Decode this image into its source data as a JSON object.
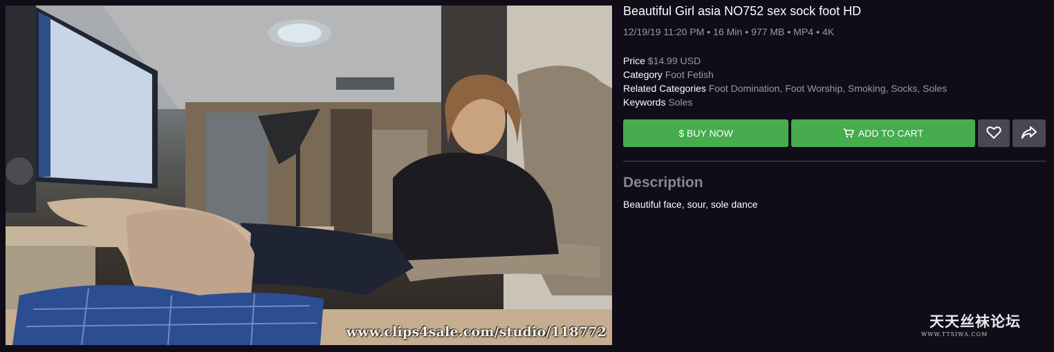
{
  "preview": {
    "watermark": "www.clips4sale.com/studio/118772"
  },
  "product": {
    "title": "Beautiful Girl asia NO752 sex sock foot HD",
    "meta": {
      "date": "12/19/19 11:20 PM",
      "duration": "16 Min",
      "size": "977 MB",
      "format": "MP4",
      "resolution": "4K",
      "separator": "•"
    },
    "details": {
      "price_label": "Price",
      "price_value": "$14.99 USD",
      "category_label": "Category",
      "category_value": "Foot Fetish",
      "related_label": "Related Categories",
      "related_value": "Foot Domination, Foot Worship, Smoking, Socks, Soles",
      "keywords_label": "Keywords",
      "keywords_value": "Soles"
    }
  },
  "actions": {
    "buy_label": "$ BUY NOW",
    "cart_label": "ADD TO CART",
    "cart_icon": "cart-icon",
    "favorite_icon": "heart-icon",
    "share_icon": "share-icon",
    "button_color": "#46ac4e",
    "secondary_color": "#4a4752"
  },
  "description": {
    "heading": "Description",
    "text": "Beautiful face, sour, sole dance"
  },
  "site_watermark": {
    "name": "天天丝袜论坛",
    "url": "WWW.TTSIWA.COM"
  },
  "colors": {
    "background": "#100c18",
    "muted_text": "#9d98a6"
  }
}
